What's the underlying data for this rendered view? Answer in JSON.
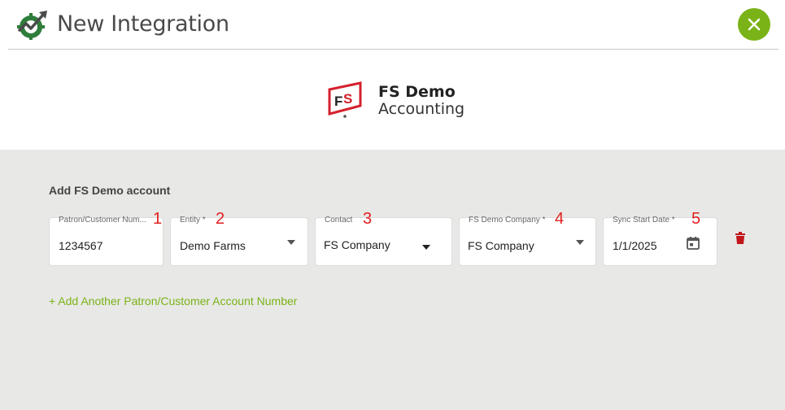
{
  "header": {
    "title": "New Integration",
    "close_icon": "close-icon"
  },
  "brand": {
    "name": "FS Demo",
    "subtitle": "Accounting"
  },
  "form": {
    "section_title": "Add FS Demo account",
    "fields": [
      {
        "label": "Patron/Customer Num...",
        "value": "1234567",
        "marker": "1"
      },
      {
        "label": "Entity *",
        "value": "Demo Farms",
        "marker": "2"
      },
      {
        "label": "Contact",
        "value": "FS Company",
        "marker": "3"
      },
      {
        "label": "FS Demo Company *",
        "value": "FS Company",
        "marker": "4"
      },
      {
        "label": "Sync Start Date *",
        "value": "1/1/2025",
        "marker": "5"
      }
    ],
    "add_link": "+ Add Another Patron/Customer Account Number"
  },
  "colors": {
    "accent": "#7ab317",
    "delete": "#c0161b",
    "marker": "#e02020",
    "panel_bg": "#e8e8e6"
  }
}
